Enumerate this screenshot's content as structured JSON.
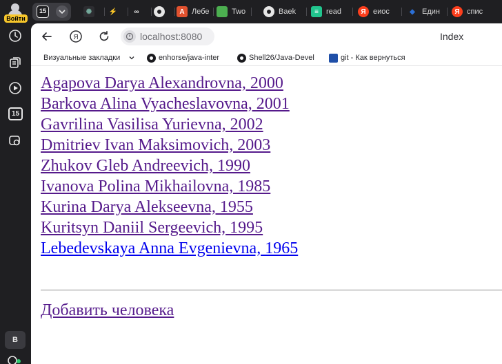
{
  "sidebar": {
    "login_label": "Войти",
    "calendar_day": "15",
    "profile_letter": "B"
  },
  "tabs": {
    "active_badge": "15",
    "items": [
      {
        "label": "",
        "icon": "chatgpt-icon",
        "color": "#74aa9c"
      },
      {
        "label": "",
        "icon": "slash-icon",
        "color": "#f29a2e"
      },
      {
        "label": "",
        "icon": "link-icon",
        "color": "#e6e6e6"
      },
      {
        "label": "",
        "icon": "github-icon",
        "color": "#e6e6e6"
      },
      {
        "label": "Лебе",
        "icon": "brave-icon",
        "color": "#e2522f"
      },
      {
        "label": "Two",
        "icon": "green-square-icon",
        "color": "#4caf50"
      },
      {
        "label": "Baek",
        "icon": "github-icon",
        "color": "#e6e6e6"
      },
      {
        "label": "read",
        "icon": "sheet-icon",
        "color": "#21c58e"
      },
      {
        "label": "еиос",
        "icon": "yandex-icon",
        "color": "#fc3f1d"
      },
      {
        "label": "Един",
        "icon": "drop-icon",
        "color": "#2b6fd6"
      },
      {
        "label": "спис",
        "icon": "yandex-icon",
        "color": "#fc3f1d"
      }
    ]
  },
  "address": {
    "url": "localhost:8080",
    "page_title": "Index"
  },
  "bookmarks": [
    {
      "label": "Визуальные закладки",
      "icon": "none"
    },
    {
      "label": "enhorse/java-inter",
      "icon": "github-icon"
    },
    {
      "label": "Shell26/Java-Devel",
      "icon": "github-icon"
    },
    {
      "label": "git - Как вернуться",
      "icon": "git-icon"
    }
  ],
  "people": [
    "Agapova Darya Alexandrovna, 2000",
    "Barkova Alina Vyacheslavovna, 2001",
    "Gavrilina Vasilisa Yurievna, 2002",
    "Dmitriev Ivan Maksimovich, 2003",
    "Zhukov Gleb Andreevich, 1990",
    "Ivanova Polina Mikhailovna, 1985",
    "Kurina Darya Alekseevna, 1955",
    "Kuritsyn Daniil Sergeevich, 1995",
    "Lebedevskaya Anna Evgenievna, 1965"
  ],
  "add_person_label": "Добавить человека",
  "colors": {
    "visited_link": "#551a8b",
    "unvisited_link": "#0000ee",
    "login_badge": "#f7c62b",
    "chrome_dark": "#1f1f22"
  }
}
